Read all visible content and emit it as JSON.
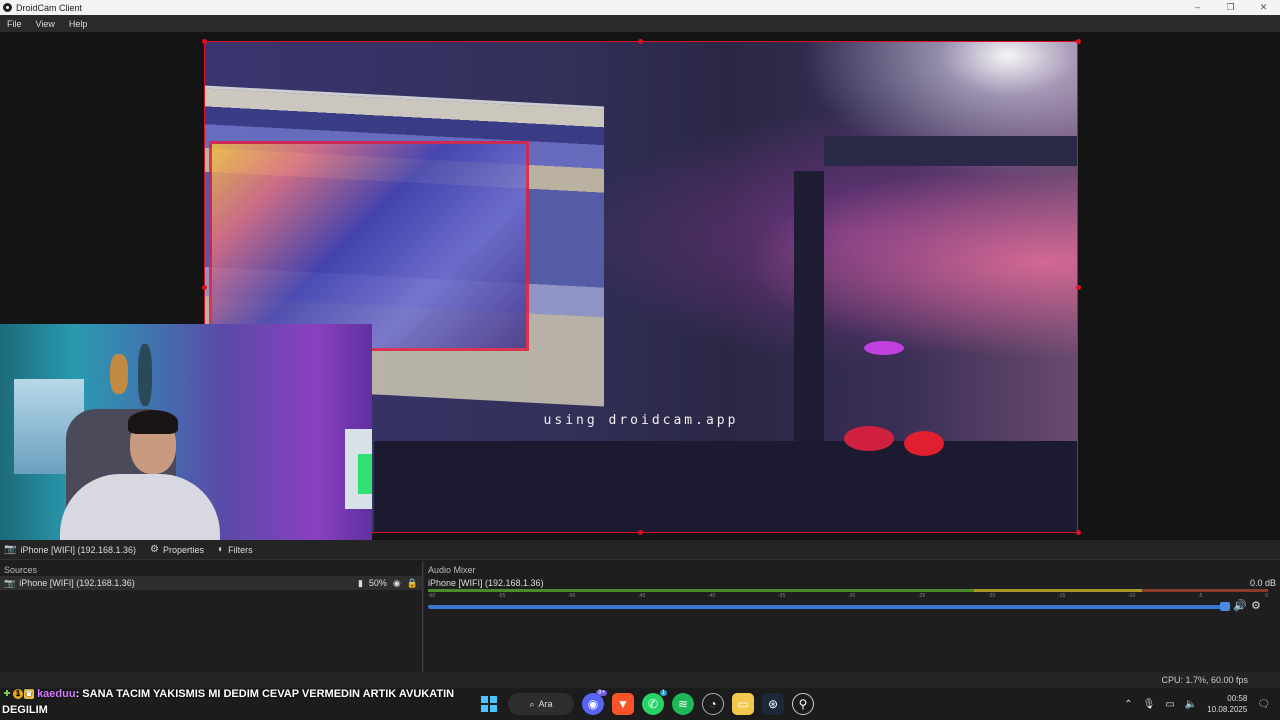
{
  "window": {
    "title": "DroidCam Client",
    "controls": [
      "–",
      "❐",
      "✕"
    ]
  },
  "menu": {
    "items": [
      "File",
      "View",
      "Help"
    ]
  },
  "preview": {
    "watermark": "using droidcam.app"
  },
  "source_bar": {
    "source_label": "iPhone [WIFI] (192.168.1.36)",
    "properties_label": "Properties",
    "filters_label": "Filters"
  },
  "sources_panel": {
    "title": "Sources",
    "rows": [
      {
        "label": "iPhone [WIFI] (192.168.1.36)",
        "volume": "50%"
      }
    ]
  },
  "audio_mixer": {
    "title": "Audio Mixer",
    "channel": "iPhone [WIFI] (192.168.1.36)",
    "level": "0.0 dB",
    "ticks": [
      "-60",
      "-55",
      "-50",
      "-45",
      "-40",
      "-35",
      "-30",
      "-25",
      "-20",
      "-15",
      "-10",
      "-5",
      "0"
    ]
  },
  "status": {
    "text": "CPU: 1.7%, 60.00 fps"
  },
  "chat_overlay": {
    "user": "kaeduu",
    "message": ": SANA TACIM YAKISMIS MI DEDIM CEVAP VERMEDIN ARTIK AVUKATIN DEGILIM"
  },
  "taskbar": {
    "search_label": "Ara",
    "discord_badge": "9+",
    "whatsapp_badge": "1",
    "time": "00:58",
    "date": "10.08.2025"
  },
  "colors": {
    "selection": "#e01020",
    "volume_slider": "#3a78d0",
    "chat_user": "#d07cff"
  }
}
